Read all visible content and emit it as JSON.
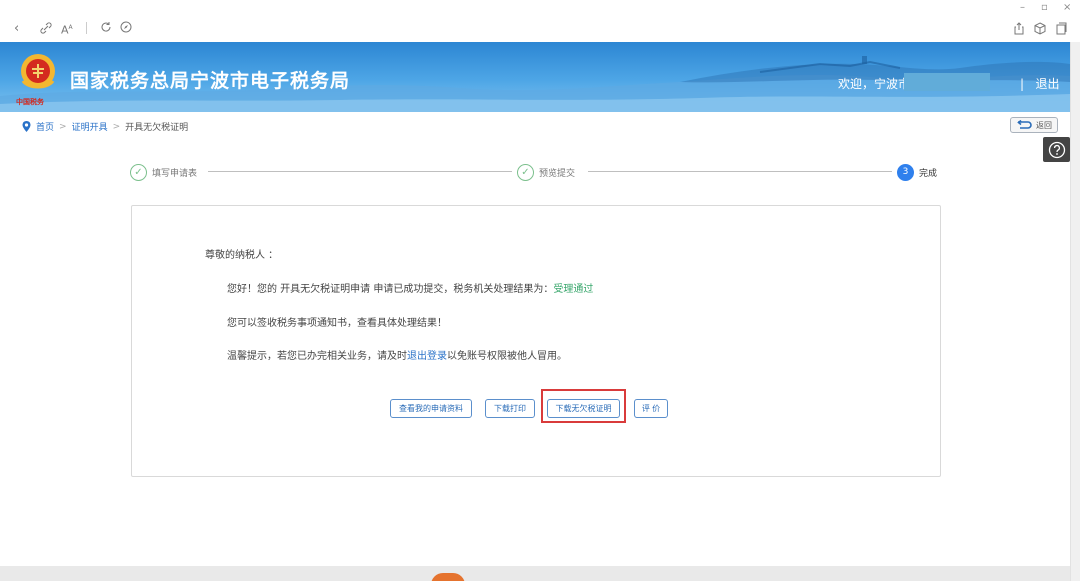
{
  "browser": {
    "icons": [
      "back-icon",
      "link-icon",
      "read-aloud-icon",
      "refresh-icon",
      "compass-icon",
      "share-icon",
      "extension-icon",
      "collections-icon"
    ],
    "window_controls": [
      "–",
      "▫",
      "×"
    ]
  },
  "header": {
    "title": "国家税务总局宁波市电子税务局",
    "emblem_caption": "中国税务",
    "welcome": "欢迎，宁波市",
    "logout": "退出"
  },
  "breadcrumb": {
    "home": "首页",
    "sep": ">",
    "section": "证明开具",
    "current": "开具无欠税证明"
  },
  "back_button": "返回",
  "steps": [
    {
      "label": "填写申请表",
      "state": "done"
    },
    {
      "label": "预览提交",
      "state": "done"
    },
    {
      "label": "完成",
      "number": "3",
      "state": "current"
    }
  ],
  "message": {
    "greeting": "尊敬的纳税人 ：",
    "line1_prefix": "您好！您的 开具无欠税证明申请 申请已成功提交，税务机关处理结果为：",
    "line1_status": "受理通过",
    "line2": "您可以签收税务事项通知书，查看具体处理结果！",
    "line3_prefix": "温馨提示，若您已办完相关业务，请及时",
    "line3_link": "退出登录",
    "line3_suffix": "以免账号权限被他人冒用。"
  },
  "actions": {
    "view": "查看我的申请资料",
    "print": "下载打印",
    "download": "下载无欠税证明",
    "rate": "评 价"
  },
  "colors": {
    "banner": "#3a93dc",
    "step_done": "#7cc08d",
    "step_current": "#2f80ed",
    "status_green": "#3aa76d",
    "link_blue": "#2a72c8",
    "highlight_red": "#d93b3b"
  }
}
